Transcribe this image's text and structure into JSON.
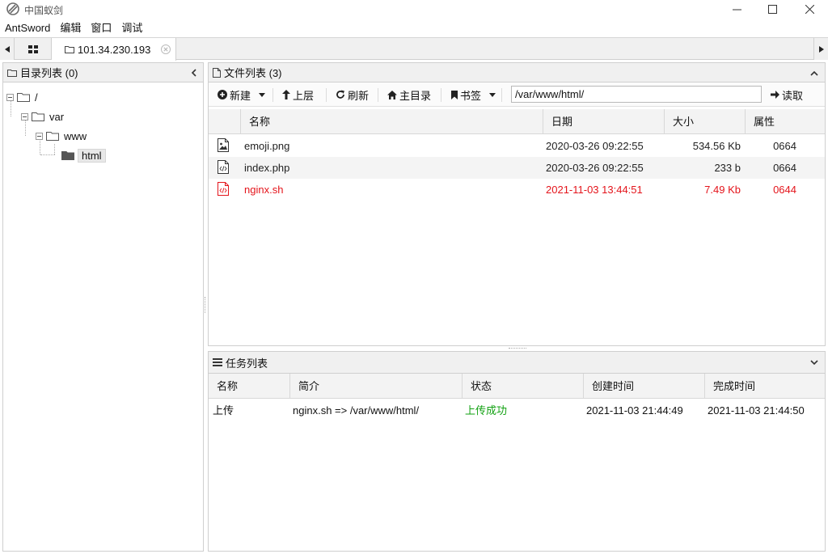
{
  "window": {
    "title": "中国蚁剑"
  },
  "menu": {
    "items": [
      "AntSword",
      "编辑",
      "窗口",
      "调试"
    ]
  },
  "tabs": {
    "active_label": "101.34.230.193"
  },
  "directory_panel": {
    "title": "目录列表 (0)",
    "tree": [
      {
        "label": "/",
        "depth": 0
      },
      {
        "label": "var",
        "depth": 1
      },
      {
        "label": "www",
        "depth": 2
      },
      {
        "label": "html",
        "depth": 3,
        "selected": true
      }
    ]
  },
  "file_panel": {
    "title": "文件列表 (3)",
    "toolbar": {
      "new_label": "新建",
      "up_label": "上层",
      "refresh_label": "刷新",
      "home_label": "主目录",
      "bookmark_label": "书签",
      "path_value": "/var/www/html/",
      "read_label": "读取"
    },
    "columns": [
      "名称",
      "日期",
      "大小",
      "属性"
    ],
    "rows": [
      {
        "name": "emoji.png",
        "date": "2020-03-26 09:22:55",
        "size": "534.56 Kb",
        "perm": "0664",
        "icon": "image-file-icon",
        "highlight": false
      },
      {
        "name": "index.php",
        "date": "2020-03-26 09:22:55",
        "size": "233 b",
        "perm": "0664",
        "icon": "code-file-icon",
        "highlight": false
      },
      {
        "name": "nginx.sh",
        "date": "2021-11-03 13:44:51",
        "size": "7.49 Kb",
        "perm": "0644",
        "icon": "code-file-icon",
        "highlight": true
      }
    ]
  },
  "task_panel": {
    "title": "任务列表",
    "columns": [
      "名称",
      "简介",
      "状态",
      "创建时间",
      "完成时间"
    ],
    "rows": [
      {
        "name": "上传",
        "desc": "nginx.sh => /var/www/html/",
        "status": "上传成功",
        "created": "2021-11-03 21:44:49",
        "finished": "2021-11-03 21:44:50"
      }
    ]
  },
  "colors": {
    "highlight_red": "#e4141b",
    "success_green": "#12a112"
  }
}
